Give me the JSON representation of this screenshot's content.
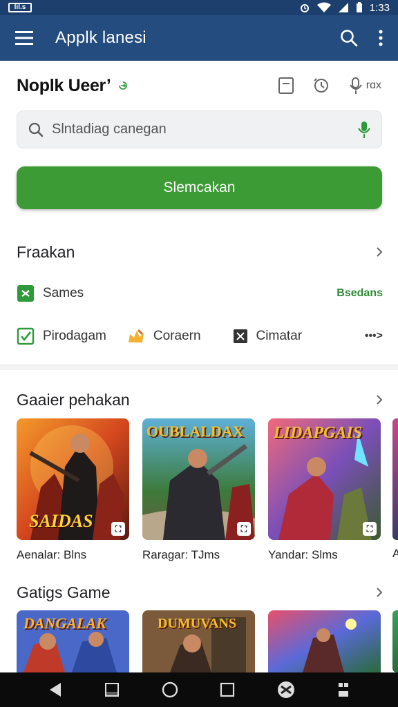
{
  "status_bar": {
    "battery_label": "lil.s",
    "time": "1:33"
  },
  "app_bar": {
    "title": "Applk lanesi"
  },
  "account": {
    "name": "Noplk Ueer’",
    "action_label": "rɑx"
  },
  "search": {
    "placeholder": "Slntadiag canegan"
  },
  "primary_button": {
    "label": "Slemcakan"
  },
  "categories": {
    "title": "Fraakan",
    "sames": {
      "label": "Sames",
      "action": "Bsedans"
    },
    "items": [
      {
        "label": "Pirodagam"
      },
      {
        "label": "Coraern"
      },
      {
        "label": "Cimatar"
      }
    ],
    "more": "•••>"
  },
  "section1": {
    "title": "Gaaier pehakan",
    "cards": [
      {
        "art_title": "SAIDAS",
        "label": "Aenalar: Blns"
      },
      {
        "art_title": "OUBLALDAX",
        "label": "Raragar: TJms"
      },
      {
        "art_title": "LIDAPGAIS",
        "label": "Yandar: Slms"
      }
    ],
    "peek_label": "A"
  },
  "section2": {
    "title": "Gatigs Game",
    "cards": [
      {
        "art_title": "DANGALAK"
      },
      {
        "art_title": "DUMUVANS"
      },
      {
        "art_title": ""
      }
    ]
  },
  "colors": {
    "appbar": "#244c7e",
    "statusbar": "#1d3f6e",
    "accent": "#3d9b35",
    "nav": "#0b0b0b"
  },
  "icons": [
    "menu-icon",
    "search-icon",
    "more-vert-icon",
    "mic-icon",
    "chevron-right-icon",
    "back-icon",
    "home-icon",
    "recents-icon"
  ]
}
